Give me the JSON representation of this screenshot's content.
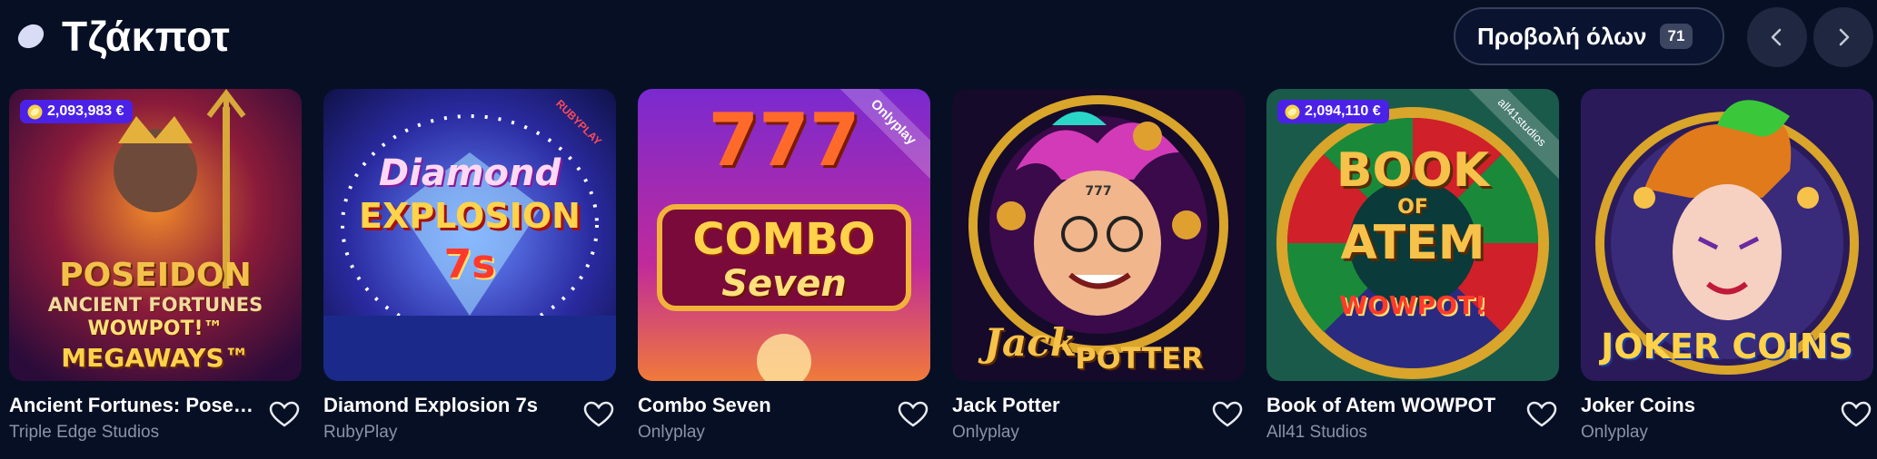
{
  "header": {
    "icon": "lemon-icon",
    "title": "Τζάκποτ",
    "view_all_label": "Προβολή όλων",
    "view_all_count": "71",
    "prev_icon": "chevron-left-icon",
    "next_icon": "chevron-right-icon"
  },
  "colors": {
    "background": "#070f24",
    "badge": "#4b21e8",
    "muted": "#8a93a8"
  },
  "games": [
    {
      "name": "Ancient Fortunes: Posei...",
      "provider": "Triple Edge Studios",
      "jackpot": "2,093,983 €",
      "art": [
        "POSEIDON",
        "ANCIENT FORTUNES",
        "WOWPOT!™",
        "MEGAWAYS™"
      ]
    },
    {
      "name": "Diamond Explosion 7s",
      "provider": "RubyPlay",
      "ribbon": "RUBYPLAY",
      "art": [
        "Diamond",
        "EXPLOSION",
        "7s"
      ]
    },
    {
      "name": "Combo Seven",
      "provider": "Onlyplay",
      "ribbon": "Onlyplay",
      "art": [
        "777",
        "COMBO",
        "Seven"
      ]
    },
    {
      "name": "Jack Potter",
      "provider": "Onlyplay",
      "art": [
        "777",
        "Jack",
        "POTTER"
      ]
    },
    {
      "name": "Book of Atem WOWPOT",
      "provider": "All41 Studios",
      "jackpot": "2,094,110 €",
      "ribbon": "all41studios",
      "art": [
        "BOOK",
        "OF",
        "ATEM",
        "WOWPOT!"
      ]
    },
    {
      "name": "Joker Coins",
      "provider": "Onlyplay",
      "art": [
        "JOKER COINS"
      ]
    }
  ]
}
